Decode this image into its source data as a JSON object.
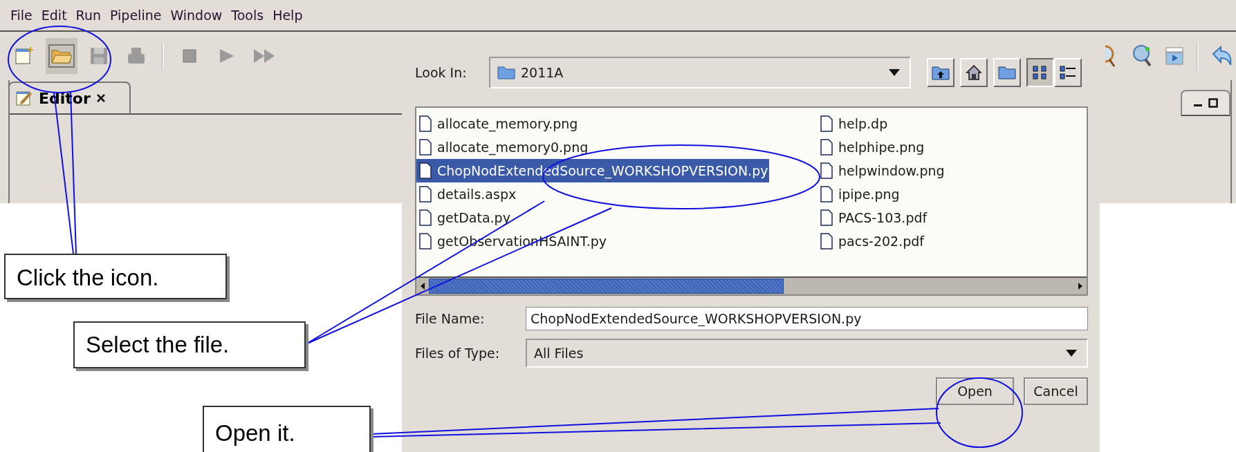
{
  "menu": [
    "File",
    "Edit",
    "Run",
    "Pipeline",
    "Window",
    "Tools",
    "Help"
  ],
  "toolbar": [
    {
      "kind": "new",
      "hovered": false,
      "disabled": false
    },
    {
      "kind": "open",
      "hovered": true,
      "disabled": false
    },
    {
      "kind": "save",
      "hovered": false,
      "disabled": true
    },
    {
      "kind": "print",
      "hovered": false,
      "disabled": true
    },
    {
      "kind": "separator"
    },
    {
      "kind": "stop",
      "hovered": false,
      "disabled": true
    },
    {
      "kind": "run",
      "hovered": false,
      "disabled": true
    },
    {
      "kind": "run_all",
      "hovered": false,
      "disabled": true
    }
  ],
  "right_toolbar": [
    {
      "kind": "inspect"
    },
    {
      "kind": "search"
    },
    {
      "kind": "movie"
    },
    {
      "kind": "separator"
    },
    {
      "kind": "undo"
    }
  ],
  "tabs": [
    {
      "label": "Editor",
      "selected": true
    }
  ],
  "dialog": {
    "look_in_label": "Look In:",
    "look_in": "2011A",
    "nav_buttons": [
      {
        "kind": "up",
        "selected": false
      },
      {
        "kind": "home",
        "selected": false
      },
      {
        "kind": "new_folder",
        "selected": false
      },
      {
        "kind": "list",
        "selected": true
      },
      {
        "kind": "details",
        "selected": false
      }
    ],
    "files": [
      {
        "name": "allocate_memory.png",
        "selected": false
      },
      {
        "name": "allocate_memory0.png",
        "selected": false
      },
      {
        "name": "ChopNodExtendedSource_WORKSHOPVERSION.py",
        "selected": true
      },
      {
        "name": "details.aspx",
        "selected": false
      },
      {
        "name": "getData.py",
        "selected": false
      },
      {
        "name": "getObservationHSAINT.py",
        "selected": false
      },
      {
        "name": "help.dp",
        "selected": false
      },
      {
        "name": "helphipe.png",
        "selected": false
      },
      {
        "name": "helpwindow.png",
        "selected": false
      },
      {
        "name": "ipipe.png",
        "selected": false
      },
      {
        "name": "PACS-103.pdf",
        "selected": false
      },
      {
        "name": "pacs-202.pdf",
        "selected": false
      }
    ],
    "file_name_label": "File Name:",
    "file_name": "ChopNodExtendedSource_WORKSHOPVERSION.py",
    "type_label": "Files of Type:",
    "type": "All Files",
    "buttons": [
      "Open",
      "Cancel"
    ]
  },
  "callouts": [
    {
      "text": "Click the icon."
    },
    {
      "text": "Select the file."
    },
    {
      "text": "Open it."
    }
  ]
}
